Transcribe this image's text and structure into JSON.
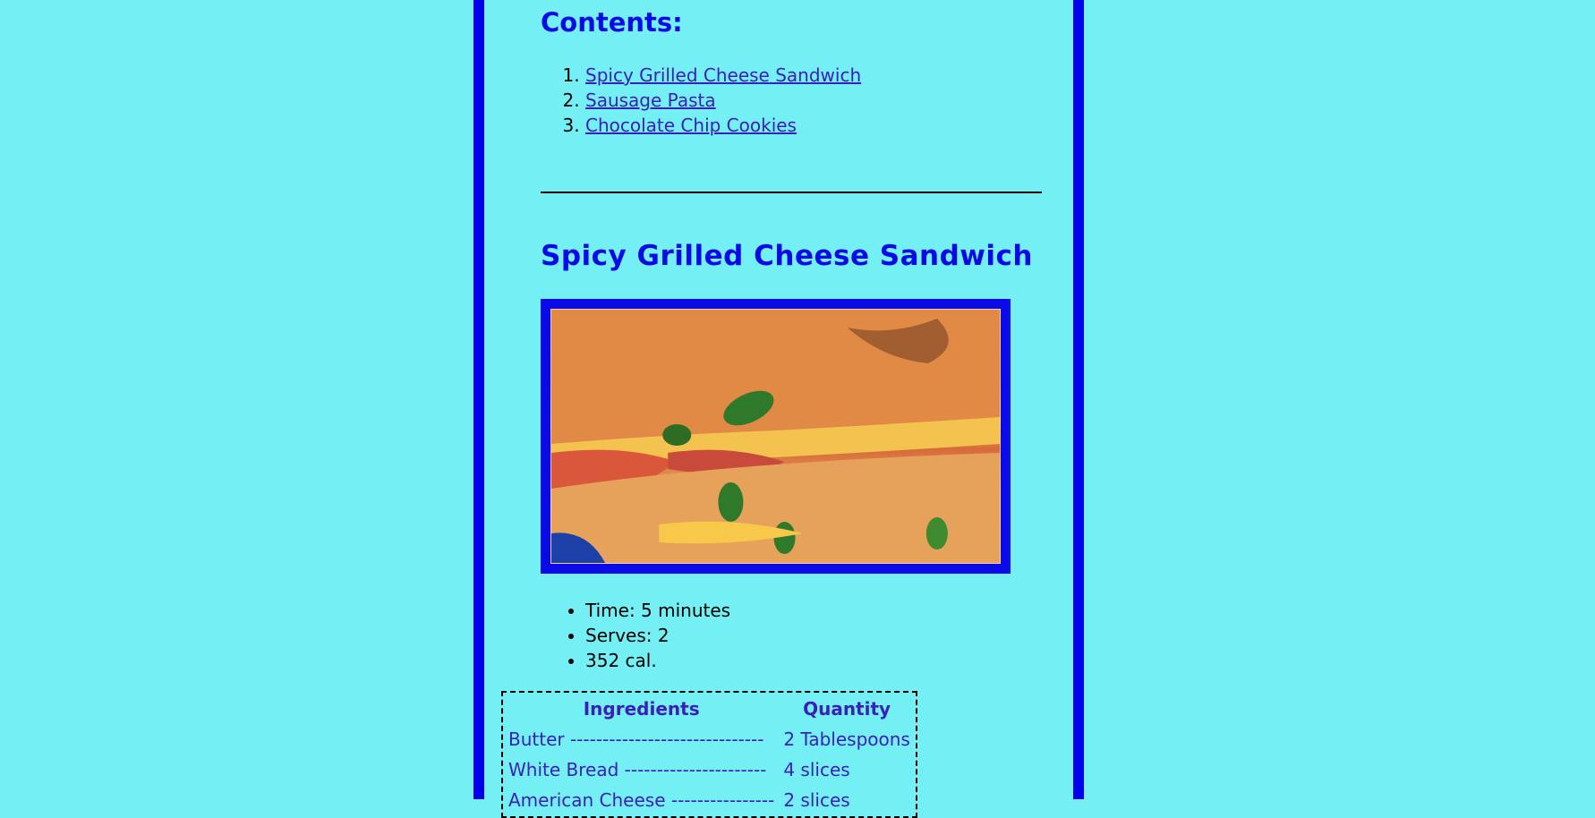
{
  "contents": {
    "title": "Contents:",
    "items": [
      {
        "label": "Spicy Grilled Cheese Sandwich"
      },
      {
        "label": "Sausage Pasta"
      },
      {
        "label": "Chocolate Chip Cookies"
      }
    ]
  },
  "recipe": {
    "title": "Spicy Grilled Cheese Sandwich",
    "meta": [
      "Time: 5 minutes",
      "Serves: 2",
      "352 cal."
    ],
    "table": {
      "headers": [
        "Ingredients",
        "Quantity"
      ],
      "rows": [
        [
          "Butter ------------------------------",
          "2 Tablespoons"
        ],
        [
          "White Bread ----------------------",
          "4 slices"
        ],
        [
          "American Cheese ----------------",
          "2 slices"
        ]
      ]
    }
  },
  "colors": {
    "background": "#74eff3",
    "border": "#0000ee",
    "heading": "#0a0ae6",
    "link": "#3a1fb8"
  }
}
